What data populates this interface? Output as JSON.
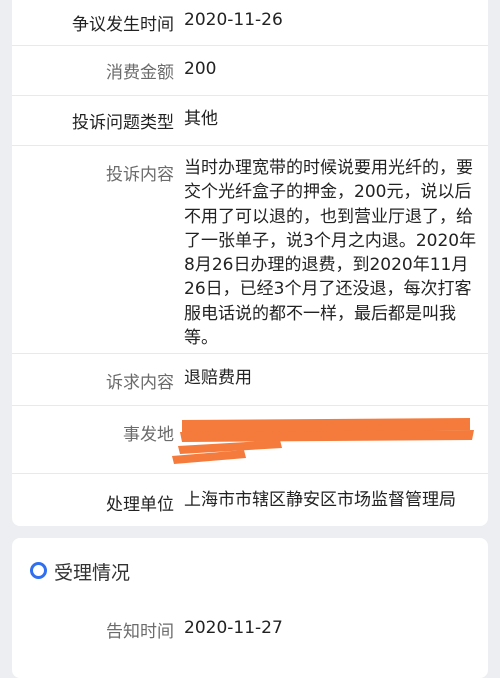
{
  "case_details": {
    "rows": [
      {
        "label": "争议发生时间",
        "value": "2020-11-26"
      },
      {
        "label": "消费金额",
        "value": "200"
      },
      {
        "label": "投诉问题类型",
        "value": "其他"
      },
      {
        "label": "投诉内容",
        "value": "当时办理宽带的时候说要用光纤的，要交个光纤盒子的押金，200元，说以后不用了可以退的，也到营业厅退了，给了一张单子，说3个月之内退。2020年8月26日办理的退费，到2020年11月26日，已经3个月了还没退，每次打客服电话说的都不一样，最后都是叫我等。"
      },
      {
        "label": "诉求内容",
        "value": "退赔费用"
      },
      {
        "label": "事发地",
        "value": ""
      },
      {
        "label": "处理单位",
        "value": "上海市市辖区静安区市场监督管理局"
      }
    ]
  },
  "acceptance": {
    "title": "受理情况",
    "rows": [
      {
        "label": "告知时间",
        "value": "2020-11-27"
      }
    ]
  },
  "colors": {
    "accent": "#2f6ff0",
    "redaction": "#f47b3c"
  }
}
